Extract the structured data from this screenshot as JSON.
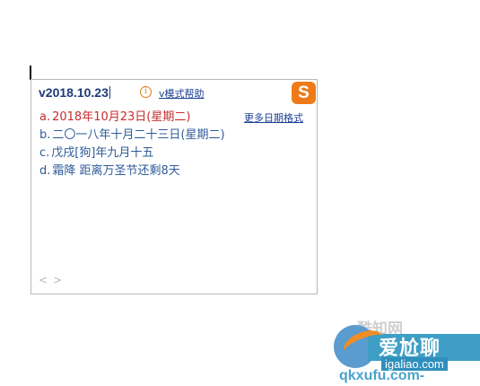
{
  "ime": {
    "composition": "v2018.10.23",
    "info_icon": "info-circle-icon",
    "help_label": "v模式帮助",
    "logo_letter": "S",
    "logo_icon": "sogou-logo",
    "more_formats_label": "更多日期格式",
    "candidates": [
      {
        "index": "a.",
        "text": "2018年10月23日(星期二)"
      },
      {
        "index": "b.",
        "text": "二〇一八年十月二十三日(星期二)"
      },
      {
        "index": "c.",
        "text": "戊戌[狗]年九月十五"
      },
      {
        "index": "d.",
        "text": "霜降 距离万圣节还剩8天"
      }
    ],
    "pager": {
      "prev": "<",
      "next": ">"
    },
    "accent_color": "#c62d2d",
    "candidate_color": "#2f5c99"
  },
  "watermark": {
    "top_text": "酷知网",
    "brand": "爱尬聊",
    "domain": "igaliao.com",
    "url": "qkxufu.com-"
  }
}
